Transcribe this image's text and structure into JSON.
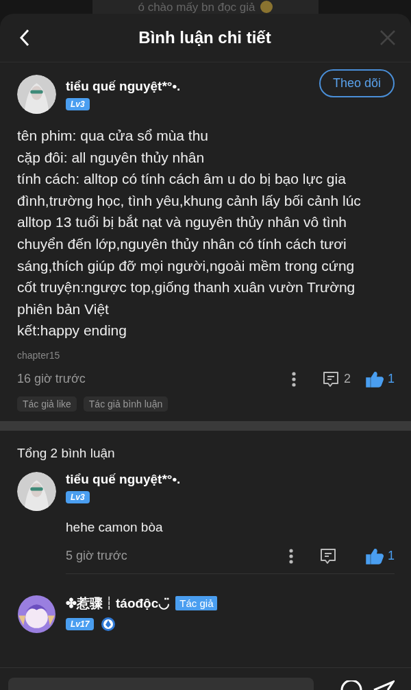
{
  "background_post": {
    "text": "ó chào mấy bn đọc giả"
  },
  "header": {
    "title": "Bình luận chi tiết"
  },
  "comment": {
    "user": {
      "name": "tiểu quế nguyệt*°•.",
      "level": "Lv3"
    },
    "follow_button": "Theo dõi",
    "paragraphs": [
      "tên phim: qua cửa sổ mùa thu",
      "cặp đôi: all nguyên thủy nhân",
      "tính cách: alltop có tính cách âm u do bị bạo lực gia đình,trường học, tình yêu,khung cảnh lấy bối cảnh lúc alltop 13 tuổi bị bắt nạt và nguyên thủy nhân vô tình chuyển đến lớp,nguyên thủy nhân có tính cách tươi sáng,thích giúp đỡ mọi người,ngoài mềm trong cứng",
      "cốt truyện:ngược top,giống thanh xuân vườn Trường phiên bản Việt",
      "kết:happy ending"
    ],
    "chapter": "chapter15",
    "time": "16 giờ trước",
    "reply_count": "2",
    "like_count": "1",
    "liked": true,
    "tags": [
      "Tác giả like",
      "Tác giả bình luận"
    ]
  },
  "replies_total": "Tổng 2 bình luận",
  "replies": [
    {
      "name": "tiểu quế nguyệt*°•.",
      "level": "Lv3",
      "author": false,
      "medal": false,
      "text": "hehe camon bòa",
      "time": "5 giờ trước",
      "like_count": "1",
      "liked": true
    },
    {
      "name": "✤惹骤┆táođộc◡̈",
      "level": "Lv17",
      "author": true,
      "author_label": "Tác giả",
      "medal": true
    }
  ]
}
